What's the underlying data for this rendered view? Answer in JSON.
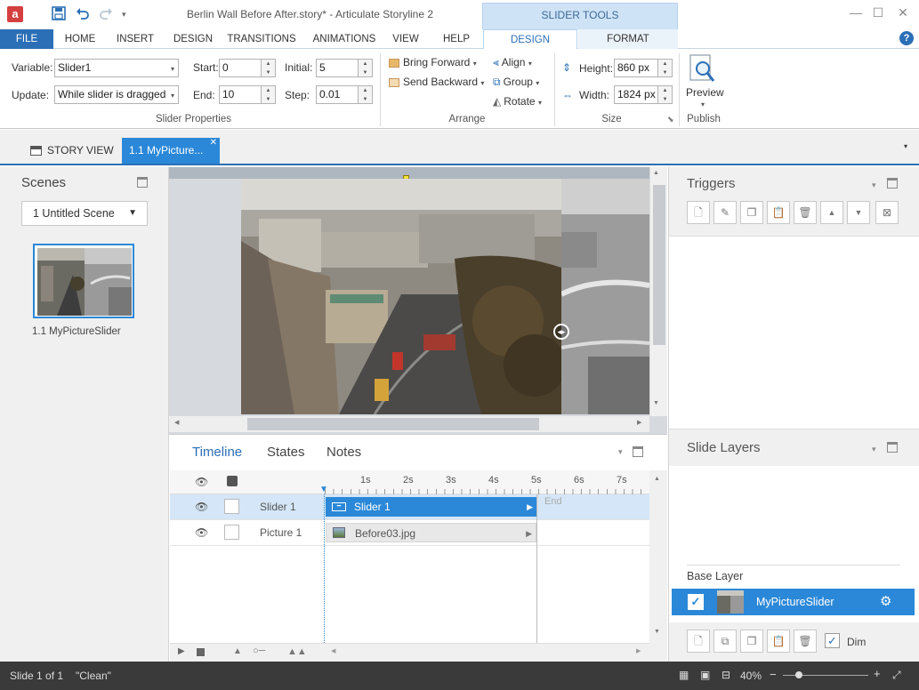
{
  "window": {
    "title": "Berlin Wall Before After.story* - Articulate Storyline 2",
    "app_logo": "a",
    "context_tools_label": "SLIDER TOOLS",
    "controls": {
      "minimize": "—",
      "maximize": "☐",
      "close": "✕"
    }
  },
  "ribbon": {
    "tabs": [
      "FILE",
      "HOME",
      "INSERT",
      "DESIGN",
      "TRANSITIONS",
      "ANIMATIONS",
      "VIEW",
      "HELP"
    ],
    "context_tabs": [
      "DESIGN",
      "FORMAT"
    ],
    "slider_properties": {
      "variable_label": "Variable:",
      "variable_value": "Slider1",
      "update_label": "Update:",
      "update_value": "While slider is dragged",
      "start_label": "Start:",
      "start_value": "0",
      "end_label": "End:",
      "end_value": "10",
      "initial_label": "Initial:",
      "initial_value": "5",
      "step_label": "Step:",
      "step_value": "0.01",
      "group_label": "Slider Properties"
    },
    "arrange": {
      "bring_forward": "Bring Forward",
      "send_backward": "Send Backward",
      "align": "Align",
      "group": "Group",
      "rotate": "Rotate",
      "group_label": "Arrange"
    },
    "size": {
      "height_label": "Height:",
      "height_value": "860 px",
      "width_label": "Width:",
      "width_value": "1824 px",
      "group_label": "Size"
    },
    "publish": {
      "preview": "Preview",
      "group_label": "Publish"
    }
  },
  "doc_tabs": {
    "story_view": "STORY VIEW",
    "slide_tab": "1.1 MyPicture..."
  },
  "scenes": {
    "title": "Scenes",
    "selected_scene": "1 Untitled Scene",
    "slide_label": "1.1 MyPictureSlider"
  },
  "timeline": {
    "tabs": [
      "Timeline",
      "States",
      "Notes"
    ],
    "ticks": [
      "1s",
      "2s",
      "3s",
      "4s",
      "5s",
      "6s",
      "7s"
    ],
    "rows": [
      {
        "name": "Slider 1",
        "bar_label": "Slider 1"
      },
      {
        "name": "Picture 1",
        "bar_label": "Before03.jpg"
      }
    ],
    "end_label": "End"
  },
  "triggers": {
    "title": "Triggers"
  },
  "slide_layers": {
    "title": "Slide Layers",
    "base_layer_label": "Base Layer",
    "layer_name": "MyPictureSlider",
    "dim_label": "Dim"
  },
  "status": {
    "slide_position": "Slide 1 of 1",
    "theme": "\"Clean\"",
    "zoom": "40%"
  },
  "colors": {
    "accent": "#2b88d8",
    "file_tab": "#2b6fb6",
    "status_bar": "#3a3a3a"
  }
}
